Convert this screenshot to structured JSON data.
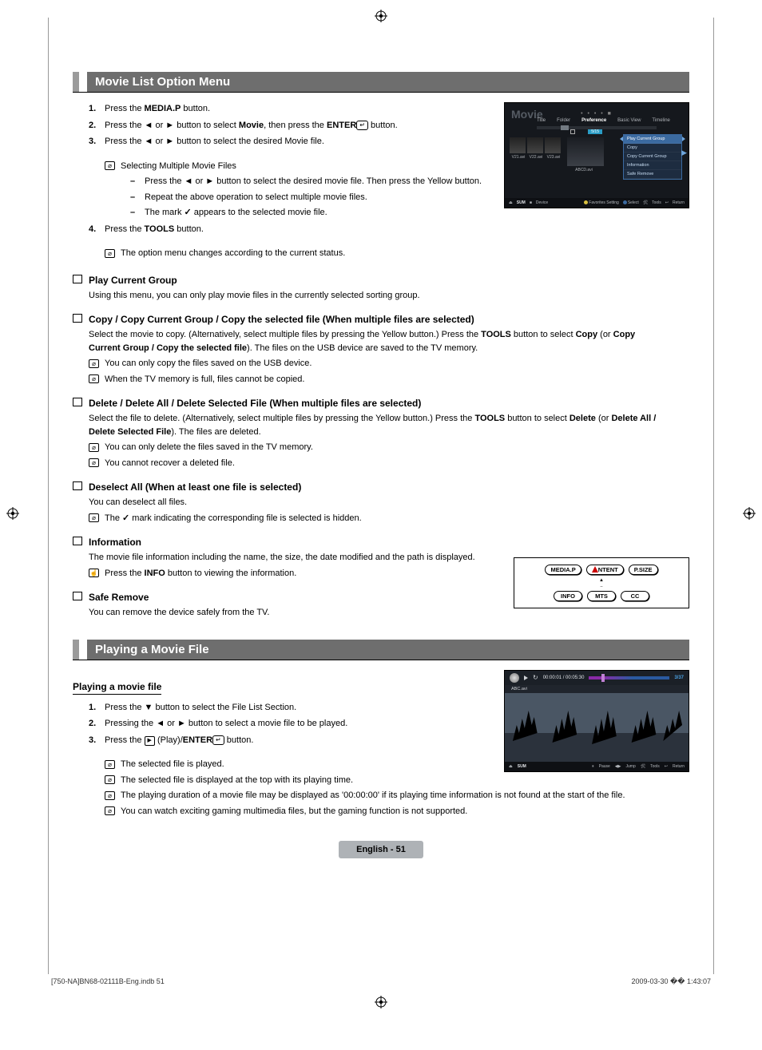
{
  "section1_title": "Movie List Option Menu",
  "steps1": {
    "n1": "1.",
    "t1a": "Press the ",
    "t1b": "MEDIA.P",
    "t1c": " button.",
    "n2": "2.",
    "t2a": "Press the ◄ or ► button to select ",
    "t2b": "Movie",
    "t2c": ", then press the ",
    "t2d": "ENTER",
    "t2e": " button.",
    "n3": "3.",
    "t3": "Press the ◄ or ► button to select the desired Movie file.",
    "note3": "Selecting Multiple Movie Files",
    "d3a": "Press the ◄ or ► button to select the desired movie file. Then press the Yellow button.",
    "d3b": "Repeat the above operation to select multiple movie files.",
    "d3c_a": "The mark ",
    "d3c_b": " appears to the selected movie file.",
    "n4": "4.",
    "t4a": "Press the ",
    "t4b": "TOOLS",
    "t4c": " button.",
    "note4": "The option menu changes according to the current status."
  },
  "subs": {
    "play_title": "Play Current Group",
    "play_body": "Using this menu, you can only play movie files in the currently selected sorting group.",
    "copy_title": "Copy / Copy Current Group / Copy the selected file (When multiple files are selected)",
    "copy_body_a": "Select the movie to copy. (Alternatively, select multiple files by pressing the Yellow button.) Press the ",
    "copy_body_b": "TOOLS",
    "copy_body_c": " button to select ",
    "copy_body_d": "Copy",
    "copy_body_e": " (or ",
    "copy_body_f": "Copy Current Group / Copy the selected file",
    "copy_body_g": "). The files on the USB device are saved to the TV memory.",
    "copy_note1": "You can only copy the files saved on the USB device.",
    "copy_note2": "When the TV memory is full, files cannot be copied.",
    "del_title": "Delete / Delete All / Delete Selected File (When multiple files are selected)",
    "del_body_a": "Select the file to delete. (Alternatively, select multiple files by pressing the Yellow button.) Press the ",
    "del_body_b": "TOOLS",
    "del_body_c": " button to select ",
    "del_body_d": "Delete",
    "del_body_e": " (or ",
    "del_body_f": "Delete All / Delete Selected File",
    "del_body_g": "). The files are deleted.",
    "del_note1": "You can only delete the files saved in the TV memory.",
    "del_note2": "You cannot recover a deleted file.",
    "desel_title": "Deselect All (When at least one file is selected)",
    "desel_body": "You can deselect all files.",
    "desel_note_a": "The ",
    "desel_note_b": " mark indicating the corresponding file is selected is hidden.",
    "info_title": "Information",
    "info_body": "The movie file information including the name, the size, the date modified and the path is displayed.",
    "info_note_a": "Press the ",
    "info_note_b": "INFO",
    "info_note_c": " button to viewing the information.",
    "safe_title": "Safe Remove",
    "safe_body": "You can remove the device safely from the TV."
  },
  "section2_title": "Playing a Movie File",
  "sub2_title": "Playing a movie file",
  "steps2": {
    "n1": "1.",
    "t1": "Press the ▼ button to select the File List Section.",
    "n2": "2.",
    "t2": "Pressing the ◄ or ► button to select a movie file to be played.",
    "n3": "3.",
    "t3a": "Press the ",
    "t3b": " (Play)/",
    "t3c": "ENTER",
    "t3d": " button.",
    "note1": "The selected file is played.",
    "note2": "The selected file is displayed at the top with its playing time.",
    "note3": "The playing duration of a movie file may be displayed as '00:00:00' if its playing time information is not found at the start of the file.",
    "note4": "You can watch exciting gaming multimedia files, but the gaming function is not supported."
  },
  "tvshot": {
    "title": "Movie",
    "tabs": {
      "t1": "Title",
      "t2": "Folder",
      "t3": "Preference",
      "t4": "Basic View",
      "t5": "Timeline"
    },
    "count": "5/15",
    "thumb1": "V21.avi",
    "thumb2": "V22.avi",
    "thumb3": "V23.avi",
    "thumb_sel": "ABCD.avi",
    "menu": {
      "m1": "Play Current Group",
      "m2": "Copy",
      "m3": "Copy Current Group",
      "m4": "Information",
      "m5": "Safe Remove"
    },
    "footer": {
      "sum": "SUM",
      "device": "Device",
      "fav": "Favorites Setting",
      "sel": "Select",
      "tools": "Tools",
      "ret": "Return"
    }
  },
  "remote": {
    "r1a": "MEDIA.P",
    "r1b": "NTENT",
    "r1c": "P.SIZE",
    "r2a": "INFO",
    "r2b": "MTS",
    "r2c": "CC"
  },
  "playshot": {
    "time": "00:00:01 / 00:05:30",
    "pct": "3/37",
    "fname": "ABC.avi",
    "footer": {
      "sum": "SUM",
      "pause": "Pause",
      "jump": "Jump",
      "tools": "Tools",
      "ret": "Return"
    }
  },
  "page_label": "English - 51",
  "footer_left": "[750-NA]BN68-02111B-Eng.indb   51",
  "footer_right": "2009-03-30   �� 1:43:07"
}
